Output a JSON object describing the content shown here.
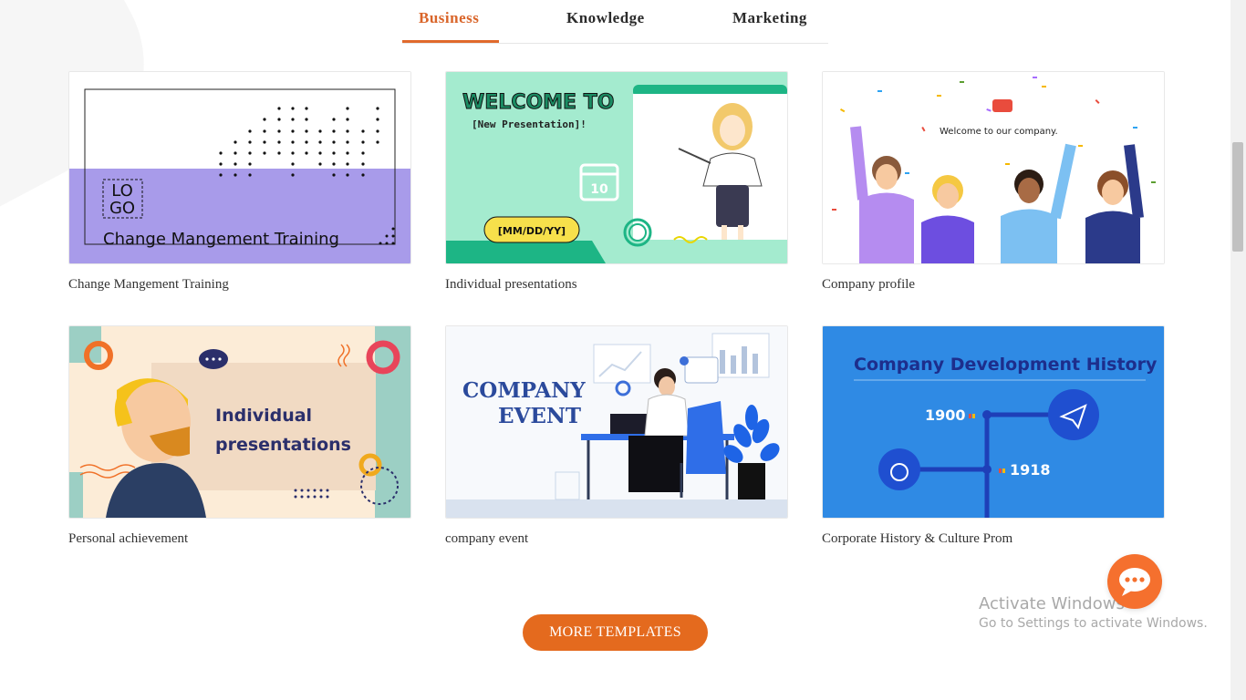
{
  "tabs": [
    {
      "label": "Business",
      "active": true
    },
    {
      "label": "Knowledge",
      "active": false
    },
    {
      "label": "Marketing",
      "active": false
    }
  ],
  "templates": [
    {
      "caption": "Change Mangement Training",
      "thumb_text": {
        "logo_line1": "LO",
        "logo_line2": "GO",
        "title": "Change Mangement Training"
      }
    },
    {
      "caption": "Individual presentations",
      "thumb_text": {
        "heading": "WELCOME TO",
        "sub": "[New Presentation]!",
        "date": "[MM/DD/YY]",
        "calendar_day": "10"
      }
    },
    {
      "caption": "Company profile",
      "thumb_text": {
        "welcome": "Welcome to our company."
      }
    },
    {
      "caption": "Personal achievement",
      "thumb_text": {
        "line1": "Individual",
        "line2": "presentations"
      }
    },
    {
      "caption": "company event",
      "thumb_text": {
        "line1": "COMPANY",
        "line2": "EVENT"
      }
    },
    {
      "caption": "Corporate History & Culture Prom",
      "thumb_text": {
        "title": "Company Development History",
        "year1": "1900",
        "year2": "1918"
      }
    }
  ],
  "more_button": "MORE TEMPLATES",
  "windows_watermark": {
    "line1": "Activate Windows",
    "line2": "Go to Settings to activate Windows."
  },
  "colors": {
    "accent": "#e46a1e",
    "tab_active": "#d9652a",
    "chat_button": "#f5702e"
  },
  "icons": {
    "chat": "chat-bubble-icon"
  }
}
